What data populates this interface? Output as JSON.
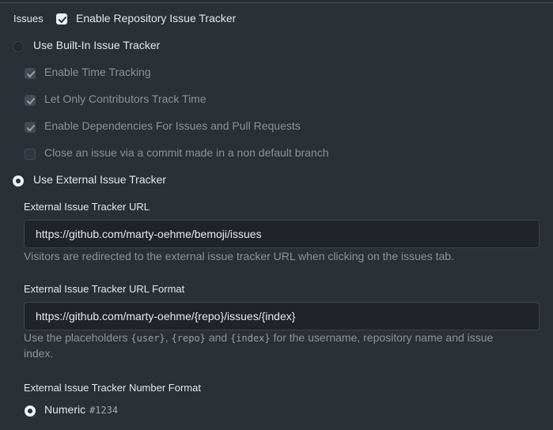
{
  "issues": {
    "section_label": "Issues",
    "enable_tracker": {
      "label": "Enable Repository Issue Tracker",
      "checked": true
    },
    "builtin": {
      "label": "Use Built-In Issue Tracker",
      "selected": false,
      "options": [
        {
          "label": "Enable Time Tracking",
          "checked": true
        },
        {
          "label": "Let Only Contributors Track Time",
          "checked": true
        },
        {
          "label": "Enable Dependencies For Issues and Pull Requests",
          "checked": true
        },
        {
          "label": "Close an issue via a commit made in a non default branch",
          "checked": false
        }
      ]
    },
    "external": {
      "label": "Use External Issue Tracker",
      "selected": true,
      "url": {
        "label": "External Issue Tracker URL",
        "value": "https://github.com/marty-oehme/bemoji/issues",
        "help": "Visitors are redirected to the external issue tracker URL when clicking on the issues tab."
      },
      "url_format": {
        "label": "External Issue Tracker URL Format",
        "value": "https://github.com/marty-oehme/{repo}/issues/{index}",
        "help_prefix": "Use the placeholders",
        "placeholder_user": "{user}",
        "comma": ",",
        "placeholder_repo": "{repo}",
        "and": "and",
        "placeholder_index": "{index}",
        "help_suffix": "for the username, repository name and issue",
        "help_line2": "index."
      },
      "number_format": {
        "label": "External Issue Tracker Number Format",
        "option_numeric": {
          "label": "Numeric",
          "example": "#1234",
          "selected": true
        }
      }
    }
  }
}
